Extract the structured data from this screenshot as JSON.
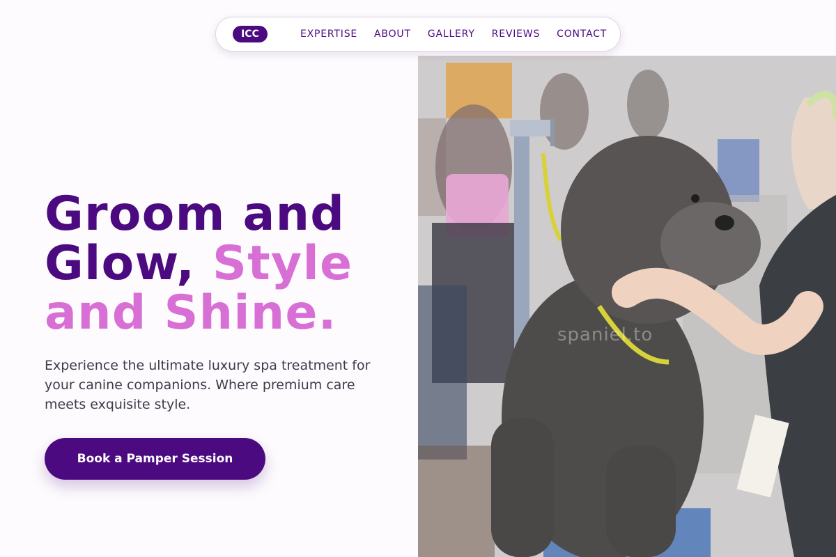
{
  "nav": {
    "logo": "ICC",
    "links": [
      {
        "label": "EXPERTISE"
      },
      {
        "label": "ABOUT"
      },
      {
        "label": "GALLERY"
      },
      {
        "label": "REVIEWS"
      },
      {
        "label": "CONTACT"
      }
    ]
  },
  "hero": {
    "headline_part1": "Groom and Glow,",
    "headline_part2": "Style and Shine.",
    "subtext": "Experience the ultimate luxury spa treatment for your canine companions. Where premium care meets exquisite style.",
    "cta_label": "Book a Pamper Session",
    "photo": {
      "watermark": "spaniel.to"
    }
  },
  "colors": {
    "brand": "#4b0a80",
    "accent": "#d86fd5",
    "text": "#3e3c4a",
    "background": "#fdfbfd"
  }
}
